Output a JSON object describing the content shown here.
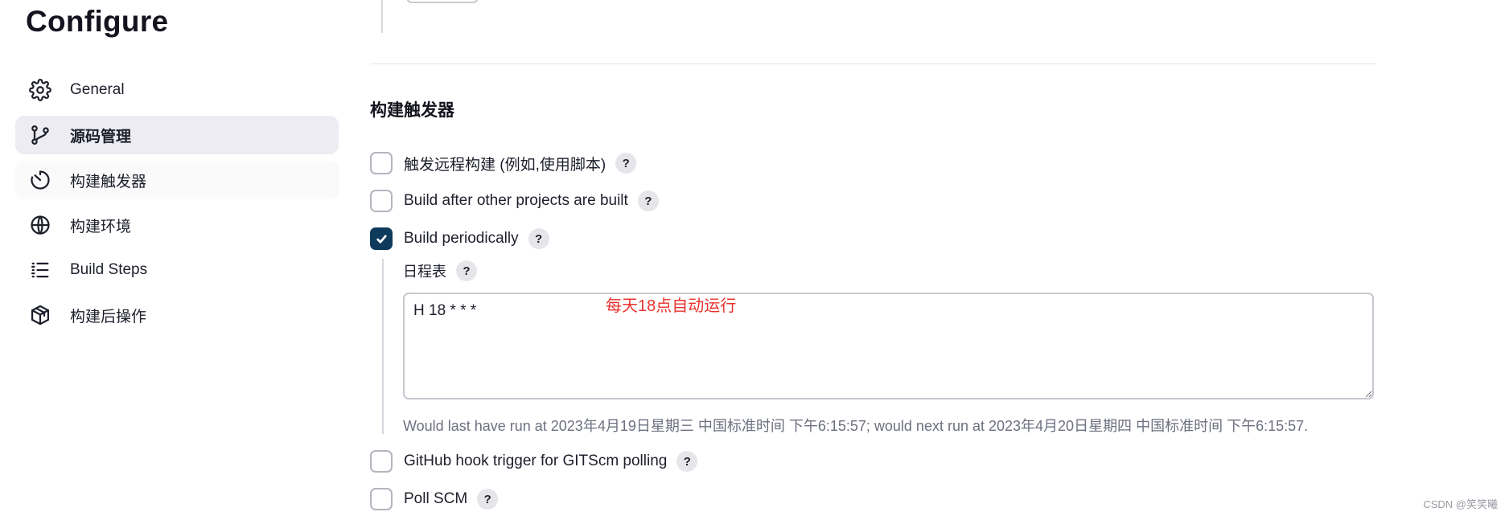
{
  "page": {
    "title": "Configure"
  },
  "sidebar": {
    "items": [
      {
        "label": "General",
        "icon": "gear-icon",
        "active": false
      },
      {
        "label": "源码管理",
        "icon": "git-branch-icon",
        "active": true
      },
      {
        "label": "构建触发器",
        "icon": "timer-icon",
        "active": false
      },
      {
        "label": "构建环境",
        "icon": "globe-icon",
        "active": false
      },
      {
        "label": "Build Steps",
        "icon": "list-icon",
        "active": false
      },
      {
        "label": "构建后操作",
        "icon": "package-icon",
        "active": false
      }
    ]
  },
  "triggers": {
    "section_title": "构建触发器",
    "options": [
      {
        "label": "触发远程构建 (例如,使用脚本)",
        "checked": false,
        "help": "?"
      },
      {
        "label": "Build after other projects are built",
        "checked": false,
        "help": "?"
      },
      {
        "label": "Build periodically",
        "checked": true,
        "help": "?"
      },
      {
        "label": "GitHub hook trigger for GITScm polling",
        "checked": false,
        "help": "?"
      },
      {
        "label": "Poll SCM",
        "checked": false,
        "help": "?"
      }
    ],
    "schedule": {
      "label": "日程表",
      "help": "?",
      "value": "H 18 * * *",
      "annotation": "每天18点自动运行",
      "validation": "Would last have run at 2023年4月19日星期三 中国标准时间 下午6:15:57; would next run at 2023年4月20日星期四 中国标准时间 下午6:15:57."
    }
  },
  "watermark": "CSDN @笑笑曦",
  "colors": {
    "accent": "#0e3a5c",
    "active_nav_bg": "#ececf2",
    "annotation": "#e8322d",
    "muted_text": "#6d7080"
  }
}
